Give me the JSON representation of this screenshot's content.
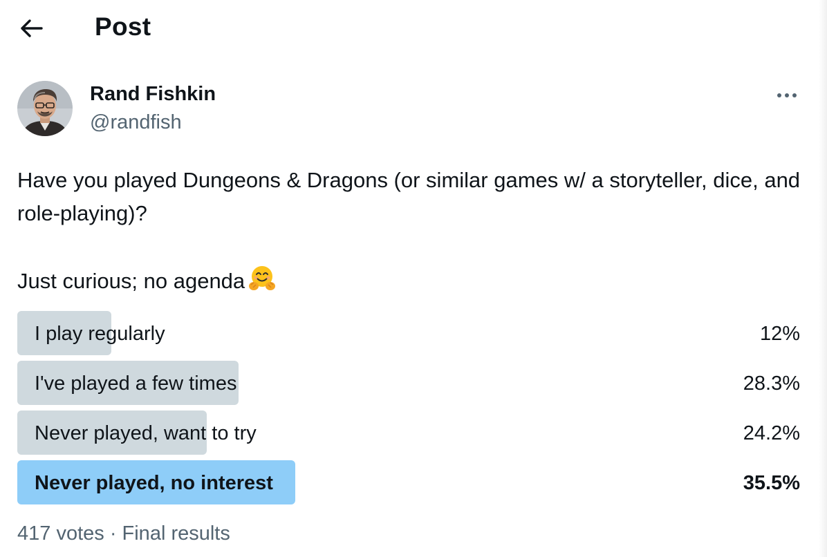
{
  "header": {
    "back_icon": "arrow-left-icon",
    "title": "Post"
  },
  "author": {
    "name": "Rand Fishkin",
    "handle": "@randfish",
    "more_icon": "ellipsis-icon"
  },
  "post": {
    "text_line1": "Have you played Dungeons & Dragons (or similar games w/ a storyteller, dice, and role-playing)?",
    "text_line2": "Just curious; no agenda",
    "emoji": "hugging-face-emoji"
  },
  "poll": {
    "options": [
      {
        "label": "I play regularly",
        "percent_text": "12%",
        "percent": 12.0,
        "winner": false
      },
      {
        "label": "I've played a few times",
        "percent_text": "28.3%",
        "percent": 28.3,
        "winner": false
      },
      {
        "label": "Never played, want to try",
        "percent_text": "24.2%",
        "percent": 24.2,
        "winner": false
      },
      {
        "label": "Never played, no interest",
        "percent_text": "35.5%",
        "percent": 35.5,
        "winner": true
      }
    ],
    "footer": "417 votes · Final results"
  },
  "colors": {
    "bar_default": "#cfd9de",
    "bar_winner": "#8ecdf8",
    "text_primary": "#0f1419",
    "text_secondary": "#536471"
  }
}
